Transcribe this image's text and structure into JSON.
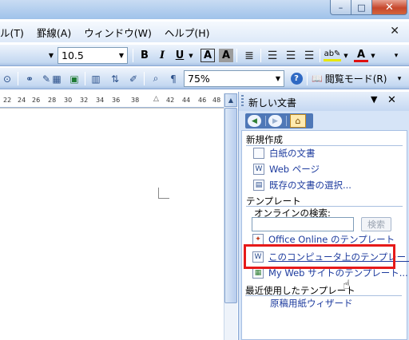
{
  "window_buttons": {
    "minimize": "–",
    "maximize": "□",
    "close": "✕"
  },
  "menubar": {
    "items": [
      "ル(T)",
      "罫線(A)",
      "ウィンドウ(W)",
      "ヘルプ(H)"
    ],
    "close": "✕"
  },
  "format_toolbar": {
    "font_size": "10.5",
    "bold": "B",
    "italic": "I",
    "underline": "U",
    "char_border": "A",
    "char_shade": "A"
  },
  "standard_toolbar": {
    "zoom": "75%",
    "help": "?",
    "reading_mode": "閲覧モード(R)"
  },
  "ruler": {
    "ticks": [
      "22",
      "24",
      "26",
      "28",
      "30",
      "32",
      "34",
      "36",
      "38",
      "42",
      "44",
      "46",
      "48"
    ]
  },
  "task_pane": {
    "title": "新しい文書",
    "menu_arrow": "▼",
    "close": "✕",
    "new_section": {
      "title": "新規作成",
      "links": [
        "白紙の文書",
        "Web ページ",
        "既存の文書の選択..."
      ]
    },
    "template_section": {
      "title": "テンプレート",
      "online_search_label": "オンラインの検索:",
      "search_value": "",
      "search_button": "検索",
      "links": [
        "Office Online のテンプレート",
        "このコンピュータ上のテンプレート...",
        "My Web サイトのテンプレート..."
      ]
    },
    "recent_section": {
      "title": "最近使用したテンプレート",
      "links": [
        "原稿用紙ウィザード"
      ]
    }
  },
  "colors": {
    "accent": "#4f78b7",
    "highlight": "#e61a1a",
    "link": "#1d3b9e"
  }
}
